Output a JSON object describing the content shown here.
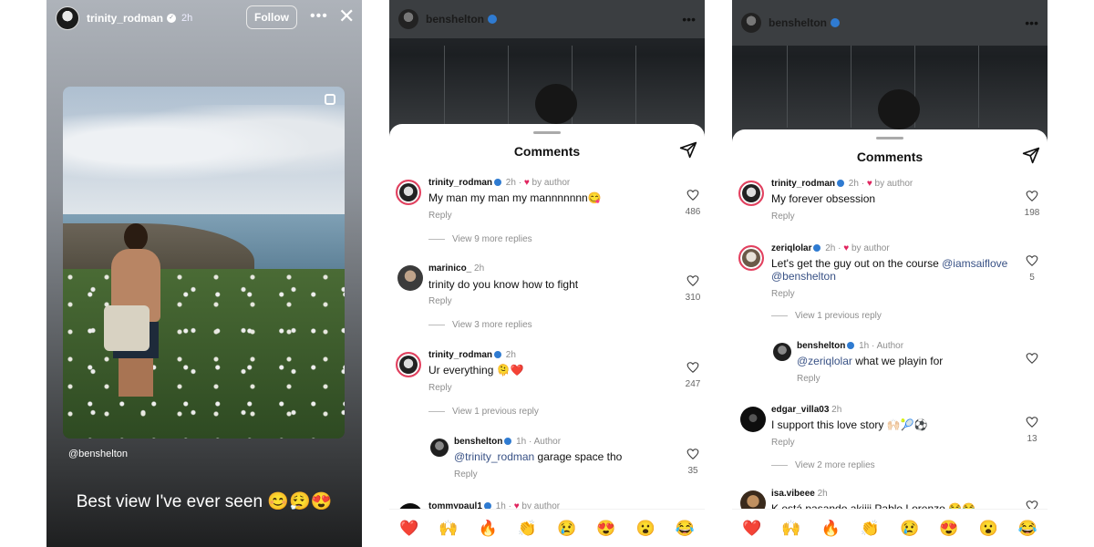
{
  "story": {
    "username": "trinity_rodman",
    "time": "2h",
    "follow_label": "Follow",
    "more_icon": "more-dots-icon",
    "close_icon": "close-icon",
    "mention": "@benshelton",
    "caption": "Best view I've ever seen 😊😮‍💨😍"
  },
  "panel2": {
    "post_username": "benshelton",
    "sheet_title": "Comments",
    "comments": [
      {
        "user": "trinity_rodman",
        "time": "2h",
        "by_author": "by author",
        "text": "My man my man my mannnnnnn😋",
        "reply": "Reply",
        "likes": "486"
      },
      {
        "view_more": "View 9 more replies"
      },
      {
        "user": "marinico_",
        "time": "2h",
        "text": "trinity do you know how to fight",
        "reply": "Reply",
        "likes": "310"
      },
      {
        "view_more": "View 3 more replies"
      },
      {
        "user": "trinity_rodman",
        "time": "2h",
        "text": "Ur everything 🫠❤️",
        "reply": "Reply",
        "likes": "247"
      },
      {
        "view_more": "View 1 previous reply"
      },
      {
        "user": "benshelton",
        "time": "1h",
        "tag": "Author",
        "mention": "@trinity_rodman",
        "text": " garage space tho",
        "reply": "Reply",
        "likes": "35"
      },
      {
        "user": "tommypaul1",
        "time": "1h",
        "by_author": "by author"
      }
    ],
    "emojis": [
      "❤️",
      "🙌",
      "🔥",
      "👏",
      "😢",
      "😍",
      "😮",
      "😂"
    ]
  },
  "panel3": {
    "post_username": "benshelton",
    "sheet_title": "Comments",
    "comments": [
      {
        "user": "trinity_rodman",
        "time": "2h",
        "by_author": "by author",
        "text": "My forever obsession",
        "reply": "Reply",
        "likes": "198"
      },
      {
        "user": "zeriqlolar",
        "time": "2h",
        "by_author": "by author",
        "text_pre": "Let's get the guy out on the course ",
        "mention1": "@iamsaiflove",
        "mention2": "@benshelton",
        "reply": "Reply",
        "likes": "5"
      },
      {
        "view_more": "View 1 previous reply"
      },
      {
        "user": "benshelton",
        "time": "1h",
        "tag": "Author",
        "mention": "@zeriqlolar",
        "text": " what we playin for",
        "reply": "Reply"
      },
      {
        "user": "edgar_villa03",
        "time": "2h",
        "text": "I support this love story 🙌🏻🎾⚽",
        "reply": "Reply",
        "likes": "13"
      },
      {
        "view_more": "View 2 more replies"
      },
      {
        "user": "isa.vibeee",
        "time": "2h",
        "text": "K está pasando akiiii Pablo Lorenzo 😂😂"
      }
    ],
    "emojis": [
      "❤️",
      "🙌",
      "🔥",
      "👏",
      "😢",
      "😍",
      "😮",
      "😂"
    ]
  },
  "colors": {
    "accent_blue": "#2f7bd1",
    "heart_red": "#e0245e",
    "link": "#385185"
  }
}
